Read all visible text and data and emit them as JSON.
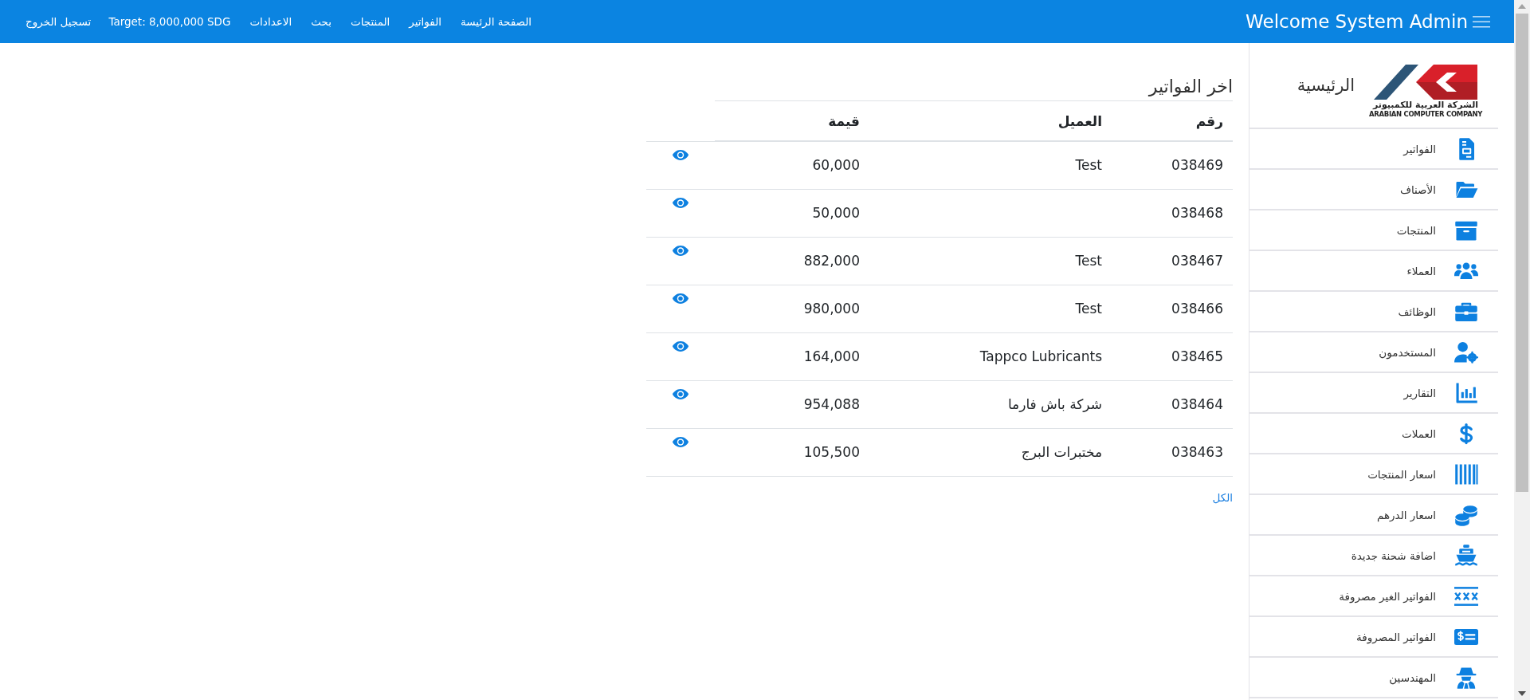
{
  "topbar": {
    "brand": "Welcome System Admin",
    "nav": [
      "الصفحة الرئيسة",
      "الفواتير",
      "المنتجات",
      "بحث",
      "الاعدادات",
      "Target: 8,000,000 SDG",
      "تسجيل الخروج"
    ]
  },
  "sidebar": {
    "home": "الرئيسية",
    "logo": {
      "arabic": "الشركة العربية للكمبيوتر",
      "english": "ARABIAN COMPUTER COMPANY"
    },
    "items": [
      {
        "label": "الفواتير"
      },
      {
        "label": "الأصناف"
      },
      {
        "label": "المنتجات"
      },
      {
        "label": "العملاء"
      },
      {
        "label": "الوظائف"
      },
      {
        "label": "المستخدمون"
      },
      {
        "label": "التقارير"
      },
      {
        "label": "العملات"
      },
      {
        "label": "اسعار المنتجات"
      },
      {
        "label": "اسعار الدرهم"
      },
      {
        "label": "اضافة شحنة جديدة"
      },
      {
        "label": "الفواتير الغير مصروفة"
      },
      {
        "label": "الفواتير المصروفة"
      },
      {
        "label": "المهندسين"
      }
    ]
  },
  "invoices": {
    "title": "اخر الفواتير",
    "columns": [
      "رقم",
      "العميل",
      "قيمة"
    ],
    "rows": [
      {
        "number": "038469",
        "customer": "Test",
        "amount": "60,000"
      },
      {
        "number": "038468",
        "amount": "50,000"
      },
      {
        "number": "038467",
        "customer": "Test",
        "amount": "882,000"
      },
      {
        "number": "038466",
        "customer": "Test",
        "amount": "980,000"
      },
      {
        "number": "038465",
        "customer": "Tappco Lubricants",
        "amount": "164,000"
      },
      {
        "number": "038464",
        "customer": "شركة باش فارما",
        "amount": "954,088"
      },
      {
        "number": "038463",
        "customer": "مختبرات البرج",
        "amount": "105,500"
      }
    ],
    "all_link": "الكل"
  }
}
